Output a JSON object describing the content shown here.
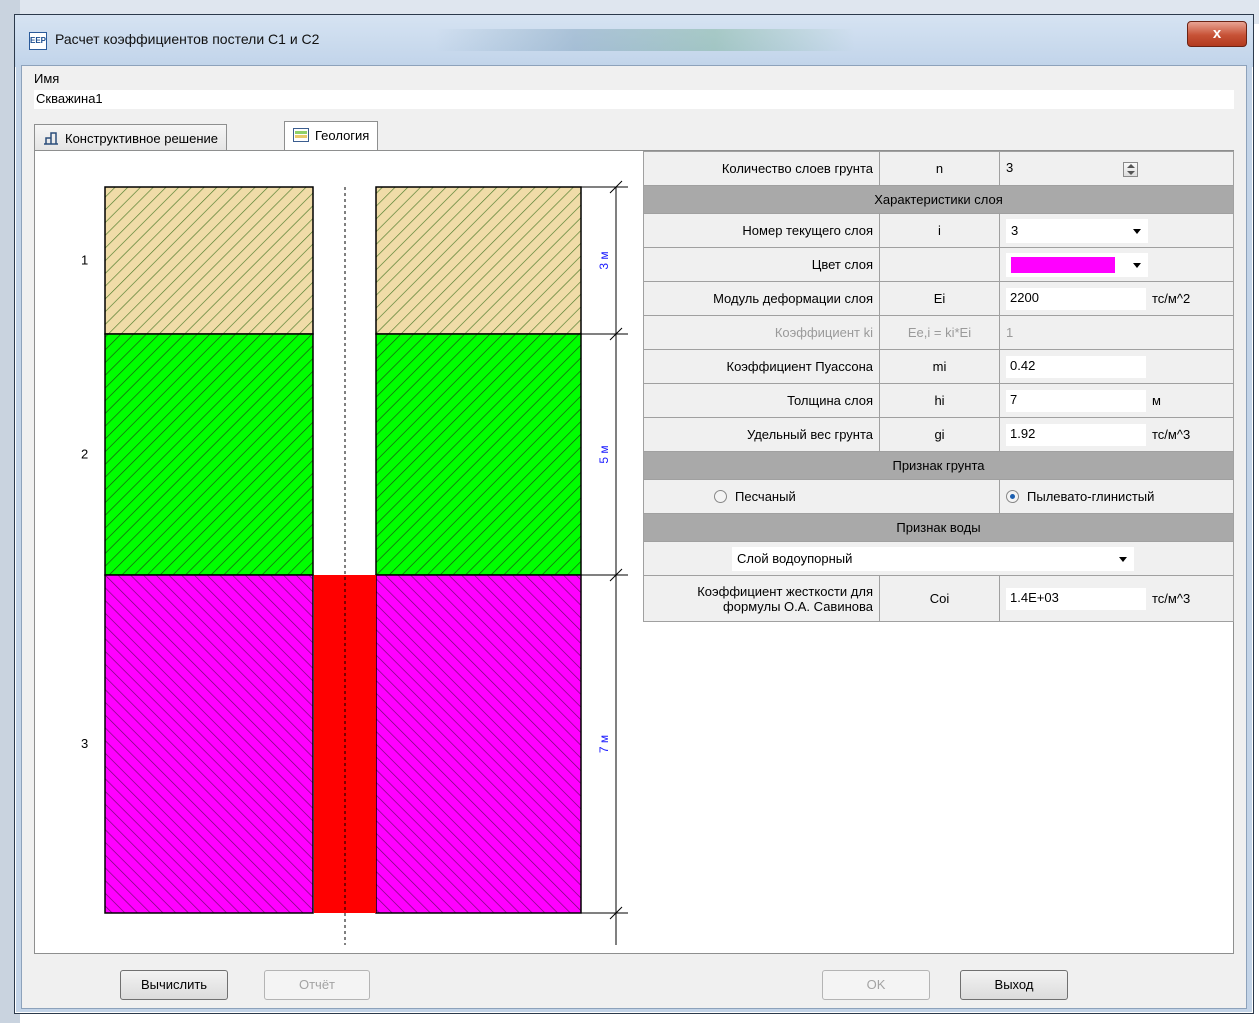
{
  "window": {
    "title": "Расчет коэффициентов постели С1 и С2",
    "close_glyph": "x",
    "app_icon_text": "EEP"
  },
  "name": {
    "label": "Имя",
    "value": "Скважина1"
  },
  "tabs": [
    {
      "label": "Конструктивное решение",
      "icon": "frame-icon"
    },
    {
      "label": "Геология",
      "icon": "geology-icon"
    }
  ],
  "drawing": {
    "layers": [
      {
        "number": "1",
        "thickness_label": "3 м",
        "color": "#f0dca8",
        "hatch_color": "#4c7a2a"
      },
      {
        "number": "2",
        "thickness_label": "5 м",
        "color": "#00ff00",
        "hatch_color": "#1a4a12"
      },
      {
        "number": "3",
        "thickness_label": "7 м",
        "color": "#ff00ff",
        "hatch_color": "#6a0d6a"
      }
    ],
    "pile_color": "#ff0000"
  },
  "grid": {
    "layer_count": {
      "label": "Количество слоев грунта",
      "symbol": "n",
      "value": "3"
    },
    "layer_header": "Характеристики слоя",
    "current_layer": {
      "label": "Номер текущего слоя",
      "symbol": "i",
      "value": "3"
    },
    "layer_color": {
      "label": "Цвет слоя",
      "value": "#ff00ff"
    },
    "deformation": {
      "label": "Модуль деформации слоя",
      "symbol": "Ei",
      "value": "2200",
      "unit": "тс/м^2"
    },
    "ki": {
      "label": "Коэффициент ki",
      "symbol": "Ee,i = ki*Ei",
      "value": "1"
    },
    "poisson": {
      "label": "Коэффициент Пуассона",
      "symbol": "mi",
      "value": "0.42"
    },
    "thickness": {
      "label": "Толщина слоя",
      "symbol": "hi",
      "value": "7",
      "unit": "м"
    },
    "unit_weight": {
      "label": "Удельный вес грунта",
      "symbol": "gi",
      "value": "1.92",
      "unit": "тс/м^3"
    },
    "soil_header": "Признак грунта",
    "soil_sandy": "Песчаный",
    "soil_clay": "Пылевато-глинистый",
    "water_header": "Признак воды",
    "water_value": "Слой водоупорный",
    "stiffness": {
      "label": "Коэффициент жесткости для формулы О.А. Савинова",
      "symbol": "Coi",
      "value": "1.4E+03",
      "unit": "тс/м^3"
    }
  },
  "buttons": {
    "calculate": "Вычислить",
    "report": "Отчёт",
    "ok": "OK",
    "exit": "Выход"
  }
}
